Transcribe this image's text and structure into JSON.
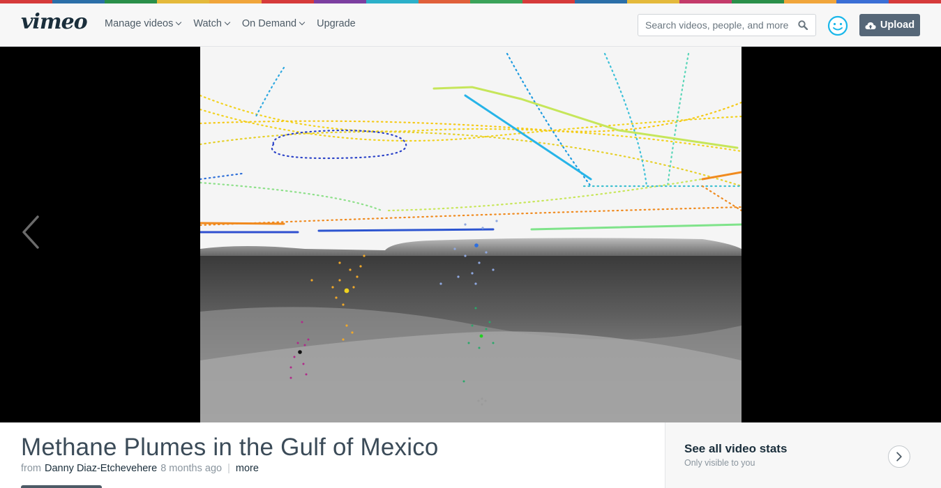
{
  "brand": {
    "logo_text": "vimeo"
  },
  "nav": [
    {
      "label": "Manage videos",
      "dropdown": true
    },
    {
      "label": "Watch",
      "dropdown": true
    },
    {
      "label": "On Demand",
      "dropdown": true
    },
    {
      "label": "Upgrade",
      "dropdown": false
    }
  ],
  "search": {
    "placeholder": "Search videos, people, and more",
    "value": "",
    "icon": "search-icon"
  },
  "user": {
    "avatar_icon": "smiley-avatar-icon"
  },
  "upload": {
    "label": "Upload",
    "icon": "cloud-upload-icon"
  },
  "player": {
    "prev_icon": "chevron-left-icon",
    "background": "#000000"
  },
  "video": {
    "title": "Methane Plumes in the Gulf of Mexico",
    "from_label": "from",
    "author": "Danny Diaz-Etchevehere",
    "age": "8 months ago",
    "more_label": "more"
  },
  "stats": {
    "title": "See all video stats",
    "subtitle": "Only visible to you",
    "button_icon": "chevron-right-icon"
  },
  "colors": {
    "accent": "#1ab7ea",
    "upload_bg": "#566778",
    "text_dark": "#1a2e3b",
    "text_muted": "#8a959e",
    "rainbow": [
      "#d63b3b",
      "#2b6fa8",
      "#2a8f4a",
      "#e4b93b",
      "#f0a53b",
      "#d63b3b",
      "#7c3fa0",
      "#2bb0c9",
      "#e0603b",
      "#3ba35a",
      "#d63b3b",
      "#2b6fa8",
      "#e4b93b",
      "#c43b6a",
      "#2a8f4a",
      "#f0a53b",
      "#3b6fd6",
      "#d63b3b"
    ]
  }
}
